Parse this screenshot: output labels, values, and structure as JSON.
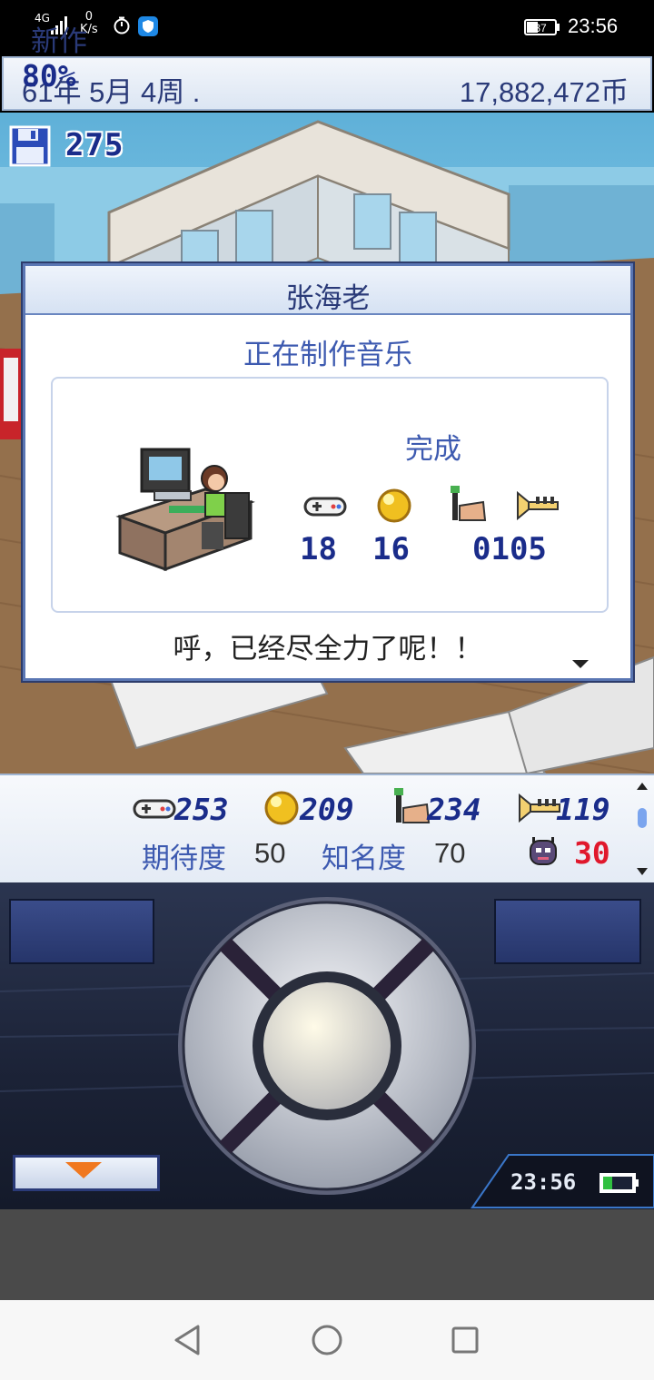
{
  "status_bar": {
    "network": "4G",
    "speed_value": "0",
    "speed_unit": "K/s",
    "battery": "37",
    "time": "23:56"
  },
  "info_bar": {
    "date": "61年 5月 4周 .",
    "money": "17,882,472币"
  },
  "save": {
    "count": "275"
  },
  "dialog": {
    "title": "张海老",
    "subtitle": "正在制作音乐",
    "complete_label": "完成",
    "stats": [
      {
        "icon": "gamepad-icon",
        "value": "18"
      },
      {
        "icon": "gold-orb-icon",
        "value": "16"
      },
      {
        "icon": "paintbrush-icon",
        "value": ""
      },
      {
        "icon": "trumpet-icon",
        "value": "0105"
      }
    ],
    "message": "呼，已经尽全力了呢！！"
  },
  "project_stats": {
    "new_label": "新作",
    "progress": "80%",
    "fun": "253",
    "creativity": "209",
    "graphics": "234",
    "sound": "119",
    "expectation_label": "期待度",
    "expectation_value": "50",
    "fame_label": "知名度",
    "fame_value": "70",
    "bugs": "30"
  },
  "controller": {
    "time": "23:56"
  },
  "colors": {
    "accent": "#2a3a78",
    "panel_border": "#5a76b3",
    "bug_red": "#e0182c"
  }
}
